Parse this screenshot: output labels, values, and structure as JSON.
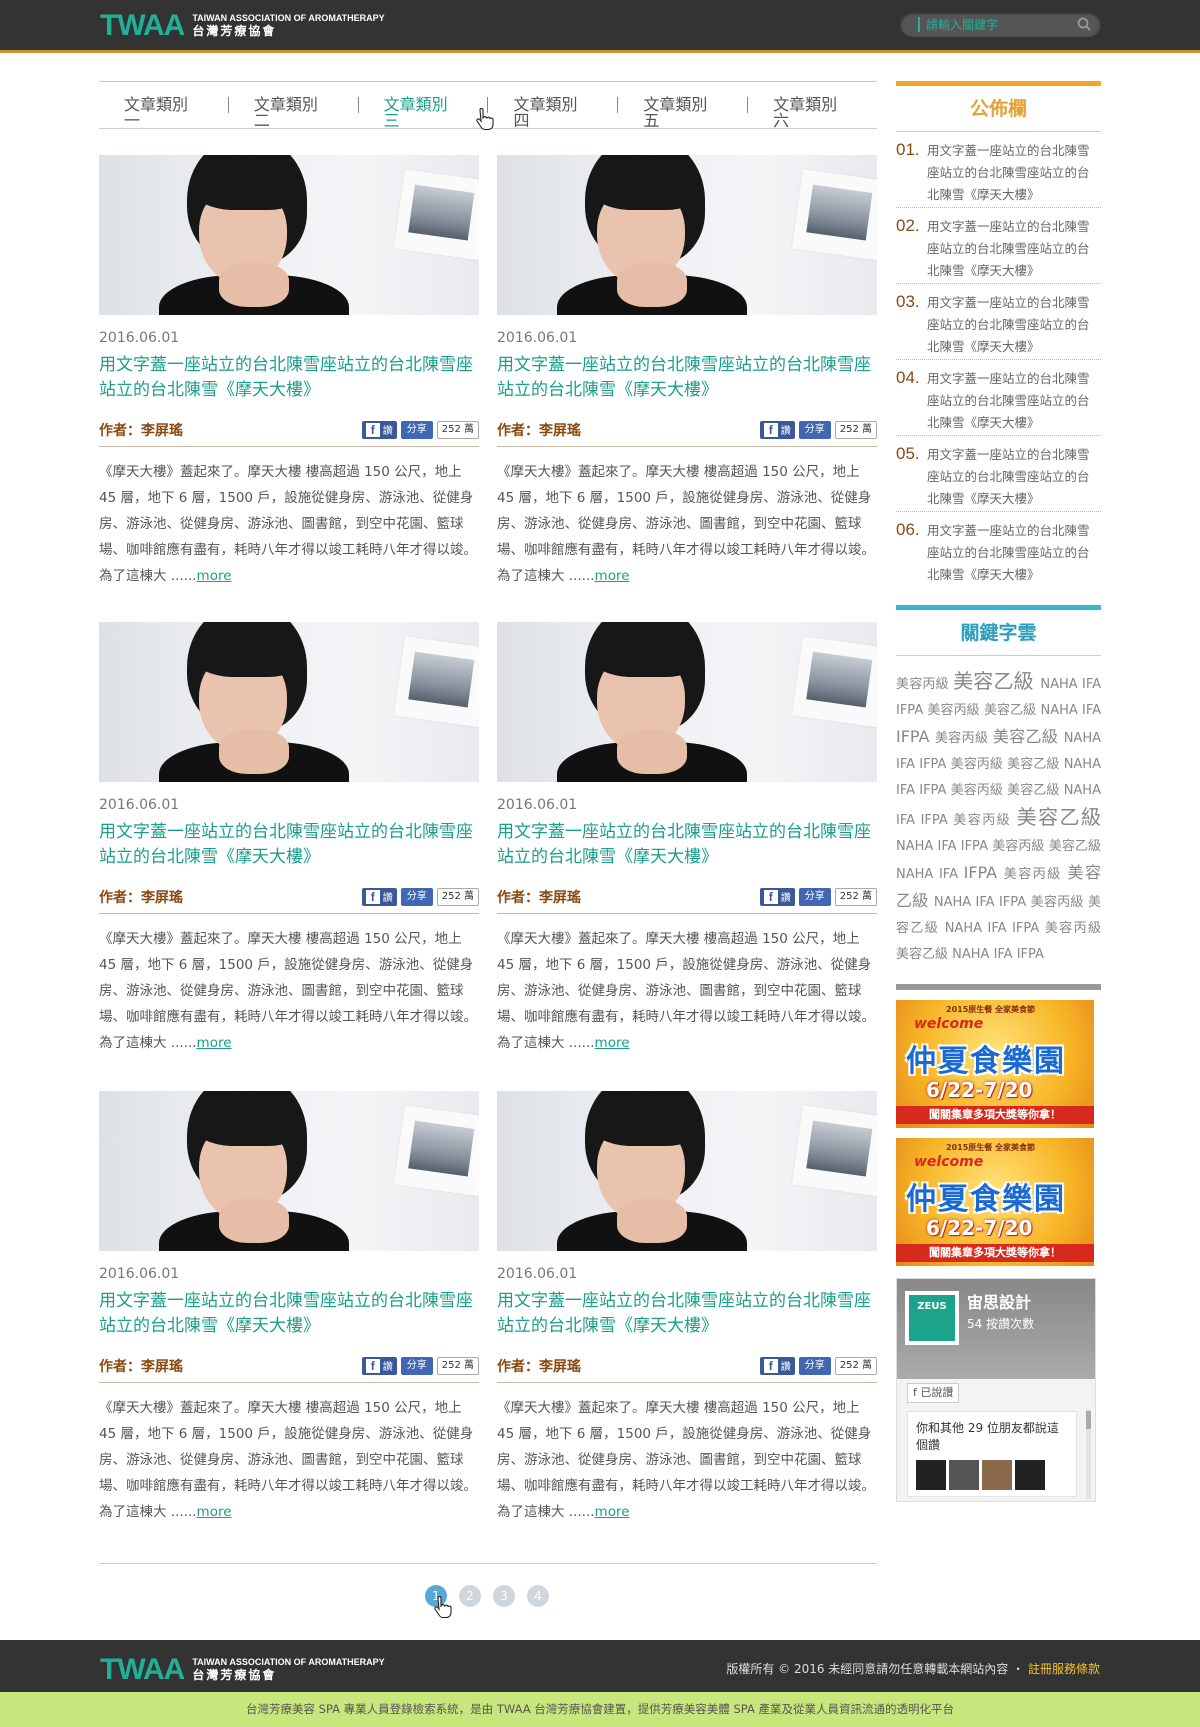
{
  "header": {
    "logo_mark": "TWAA",
    "logo_en": "TAIWAN ASSOCIATION OF AROMATHERAPY",
    "logo_zh": "台灣芳療協會",
    "search_placeholder": "請輸入關鍵字"
  },
  "tabs": [
    {
      "label": "文章類別一"
    },
    {
      "label": "文章類別二"
    },
    {
      "label": "文章類別三",
      "active": true
    },
    {
      "label": "文章類別四"
    },
    {
      "label": "文章類別五"
    },
    {
      "label": "文章類別六"
    }
  ],
  "articles": [
    {
      "date": "2016.06.01",
      "title": "用文字蓋一座站立的台北陳雪座站立的台北陳雪座站立的台北陳雪《摩天大樓》",
      "author": "作者：李屏瑤",
      "fb_read": "讚",
      "fb_share": "分享",
      "fb_count": "252 萬",
      "excerpt": "《摩天大樓》蓋起來了。摩天大樓 樓高超過 150 公尺，地上 45 層，地下 6 層，1500 戶，設施從健身房、游泳池、從健身房、游泳池、從健身房、游泳池、圖書館，到空中花園、籃球場、咖啡館應有盡有，耗時八年才得以竣工耗時八年才得以竣。為了這棟大 ......",
      "more": "more"
    },
    {
      "date": "2016.06.01",
      "title": "用文字蓋一座站立的台北陳雪座站立的台北陳雪座站立的台北陳雪《摩天大樓》",
      "author": "作者：李屏瑤",
      "fb_read": "讚",
      "fb_share": "分享",
      "fb_count": "252 萬",
      "excerpt": "《摩天大樓》蓋起來了。摩天大樓 樓高超過 150 公尺，地上 45 層，地下 6 層，1500 戶，設施從健身房、游泳池、從健身房、游泳池、從健身房、游泳池、圖書館，到空中花園、籃球場、咖啡館應有盡有，耗時八年才得以竣工耗時八年才得以竣。為了這棟大 ......",
      "more": "more"
    },
    {
      "date": "2016.06.01",
      "title": "用文字蓋一座站立的台北陳雪座站立的台北陳雪座站立的台北陳雪《摩天大樓》",
      "author": "作者：李屏瑤",
      "fb_read": "讚",
      "fb_share": "分享",
      "fb_count": "252 萬",
      "excerpt": "《摩天大樓》蓋起來了。摩天大樓 樓高超過 150 公尺，地上 45 層，地下 6 層，1500 戶，設施從健身房、游泳池、從健身房、游泳池、從健身房、游泳池、圖書館，到空中花園、籃球場、咖啡館應有盡有，耗時八年才得以竣工耗時八年才得以竣。為了這棟大 ......",
      "more": "more"
    },
    {
      "date": "2016.06.01",
      "title": "用文字蓋一座站立的台北陳雪座站立的台北陳雪座站立的台北陳雪《摩天大樓》",
      "author": "作者：李屏瑤",
      "fb_read": "讚",
      "fb_share": "分享",
      "fb_count": "252 萬",
      "excerpt": "《摩天大樓》蓋起來了。摩天大樓 樓高超過 150 公尺，地上 45 層，地下 6 層，1500 戶，設施從健身房、游泳池、從健身房、游泳池、從健身房、游泳池、圖書館，到空中花園、籃球場、咖啡館應有盡有，耗時八年才得以竣工耗時八年才得以竣。為了這棟大 ......",
      "more": "more"
    },
    {
      "date": "2016.06.01",
      "title": "用文字蓋一座站立的台北陳雪座站立的台北陳雪座站立的台北陳雪《摩天大樓》",
      "author": "作者：李屏瑤",
      "fb_read": "讚",
      "fb_share": "分享",
      "fb_count": "252 萬",
      "excerpt": "《摩天大樓》蓋起來了。摩天大樓 樓高超過 150 公尺，地上 45 層，地下 6 層，1500 戶，設施從健身房、游泳池、從健身房、游泳池、從健身房、游泳池、圖書館，到空中花園、籃球場、咖啡館應有盡有，耗時八年才得以竣工耗時八年才得以竣。為了這棟大 ......",
      "more": "more"
    },
    {
      "date": "2016.06.01",
      "title": "用文字蓋一座站立的台北陳雪座站立的台北陳雪座站立的台北陳雪《摩天大樓》",
      "author": "作者：李屏瑤",
      "fb_read": "讚",
      "fb_share": "分享",
      "fb_count": "252 萬",
      "excerpt": "《摩天大樓》蓋起來了。摩天大樓 樓高超過 150 公尺，地上 45 層，地下 6 層，1500 戶，設施從健身房、游泳池、從健身房、游泳池、從健身房、游泳池、圖書館，到空中花園、籃球場、咖啡館應有盡有，耗時八年才得以竣工耗時八年才得以竣。為了這棟大 ......",
      "more": "more"
    }
  ],
  "pagination": {
    "pages": [
      "1",
      "2",
      "3",
      "4"
    ],
    "current": "1"
  },
  "sidebar": {
    "notice_title": "公佈欄",
    "notices": [
      {
        "num": "01.",
        "text": "用文字蓋一座站立的台北陳雪座站立的台北陳雪座站立的台北陳雪《摩天大樓》"
      },
      {
        "num": "02.",
        "text": "用文字蓋一座站立的台北陳雪座站立的台北陳雪座站立的台北陳雪《摩天大樓》"
      },
      {
        "num": "03.",
        "text": "用文字蓋一座站立的台北陳雪座站立的台北陳雪座站立的台北陳雪《摩天大樓》"
      },
      {
        "num": "04.",
        "text": "用文字蓋一座站立的台北陳雪座站立的台北陳雪座站立的台北陳雪《摩天大樓》"
      },
      {
        "num": "05.",
        "text": "用文字蓋一座站立的台北陳雪座站立的台北陳雪座站立的台北陳雪《摩天大樓》"
      },
      {
        "num": "06.",
        "text": "用文字蓋一座站立的台北陳雪座站立的台北陳雪座站立的台北陳雪《摩天大樓》"
      }
    ],
    "keyword_title": "關鍵字雲",
    "keywords": [
      {
        "t": "美容丙級",
        "s": ""
      },
      {
        "t": "美容乙級",
        "s": "big"
      },
      {
        "t": "NAHA",
        "s": ""
      },
      {
        "t": "IFA",
        "s": ""
      },
      {
        "t": "IFPA",
        "s": ""
      },
      {
        "t": "美容丙級",
        "s": ""
      },
      {
        "t": "美容乙級",
        "s": ""
      },
      {
        "t": "NAHA",
        "s": ""
      },
      {
        "t": "IFA",
        "s": ""
      },
      {
        "t": "IFPA",
        "s": "mid"
      },
      {
        "t": "美容丙級",
        "s": ""
      },
      {
        "t": "美容乙級",
        "s": "mid"
      },
      {
        "t": "NAHA",
        "s": ""
      },
      {
        "t": "IFA",
        "s": ""
      },
      {
        "t": "IFPA",
        "s": ""
      },
      {
        "t": "美容丙級",
        "s": ""
      },
      {
        "t": "美容乙級",
        "s": ""
      },
      {
        "t": "NAHA",
        "s": ""
      },
      {
        "t": "IFA",
        "s": ""
      },
      {
        "t": "IFPA",
        "s": ""
      },
      {
        "t": "美容丙級",
        "s": ""
      },
      {
        "t": "美容乙級",
        "s": ""
      },
      {
        "t": "NAHA",
        "s": ""
      },
      {
        "t": "IFA",
        "s": ""
      },
      {
        "t": "IFPA",
        "s": ""
      },
      {
        "t": "美容丙級",
        "s": ""
      },
      {
        "t": "美容乙級",
        "s": "big"
      },
      {
        "t": "NAHA",
        "s": ""
      },
      {
        "t": "IFA",
        "s": ""
      },
      {
        "t": "IFPA",
        "s": ""
      },
      {
        "t": "美容丙級",
        "s": ""
      },
      {
        "t": "美容乙級",
        "s": ""
      },
      {
        "t": "NAHA",
        "s": ""
      },
      {
        "t": "IFA",
        "s": ""
      },
      {
        "t": "IFPA",
        "s": "mid"
      },
      {
        "t": "美容丙級",
        "s": ""
      },
      {
        "t": "美容乙級",
        "s": "mid"
      },
      {
        "t": "NAHA",
        "s": ""
      },
      {
        "t": "IFA",
        "s": ""
      },
      {
        "t": "IFPA",
        "s": ""
      },
      {
        "t": "美容丙級",
        "s": ""
      },
      {
        "t": "美容乙級",
        "s": ""
      },
      {
        "t": "NAHA",
        "s": ""
      },
      {
        "t": "IFA",
        "s": ""
      },
      {
        "t": "IFPA",
        "s": ""
      },
      {
        "t": "美容丙級",
        "s": ""
      },
      {
        "t": "美容乙級",
        "s": ""
      },
      {
        "t": "NAHA",
        "s": ""
      },
      {
        "t": "IFA",
        "s": ""
      },
      {
        "t": "IFPA",
        "s": ""
      }
    ],
    "banners": [
      {
        "top": "2015原生餐 全家美食節",
        "welcome": "welcome",
        "title": "仲夏食樂園",
        "year": "2015",
        "date": "6/22-7/20",
        "sub": "闖關集章多項大獎等你拿！"
      },
      {
        "top": "2015原生餐 全家美食節",
        "welcome": "welcome",
        "title": "仲夏食樂園",
        "year": "2015",
        "date": "6/22-7/20",
        "sub": "闖關集章多項大獎等你拿！"
      }
    ],
    "fb": {
      "logo": "ZEUS",
      "name": "宙思設計",
      "likes": "54 按讚次數",
      "liked": "已說讚",
      "friends": "你和其他 29 位朋友都說這個讚"
    }
  },
  "footer": {
    "logo_mark": "TWAA",
    "logo_en": "TAIWAN ASSOCIATION OF AROMATHERAPY",
    "logo_zh": "台灣芳療協會",
    "copyright": "版權所有 © 2016 未經同意請勿任意轉載本網站內容",
    "separator": "・",
    "terms": "註冊服務條款",
    "bottom_text": "台灣芳療美容 SPA 專業人員登錄檢索系統，是由 TWAA 台灣芳療協會建置，提供芳療美容美體 SPA 產業及從業人員資訊流通的透明化平台"
  },
  "colors": {
    "accent": "#1aa08a",
    "header_bg": "#333333",
    "notice": "#e5a23a",
    "keyword": "#2f9fc0",
    "bottom_bar": "#c7e77d"
  }
}
